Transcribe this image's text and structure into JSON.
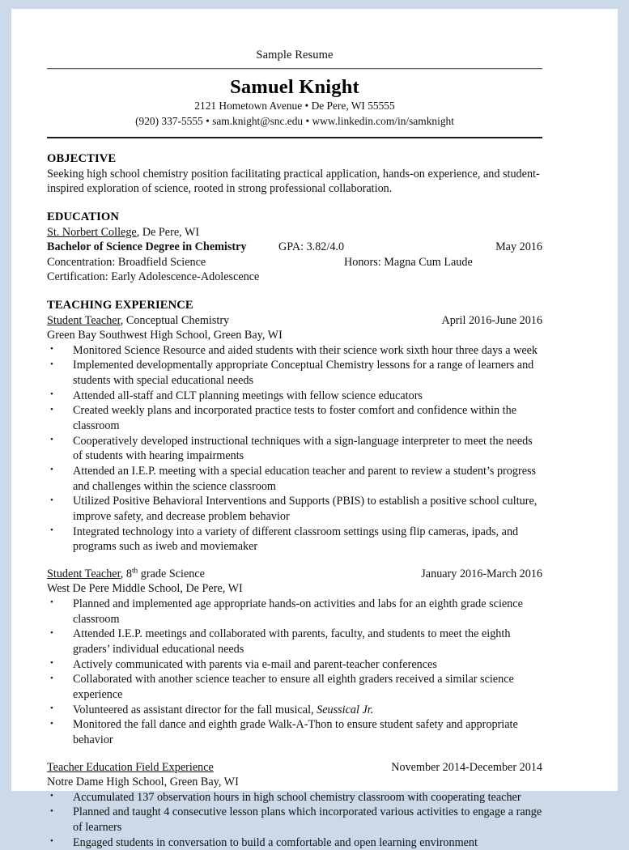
{
  "document": {
    "title": "Sample Resume"
  },
  "header": {
    "name": "Samuel Knight",
    "address_line": "2121 Hometown Avenue • De Pere, WI 55555",
    "contact_line": "(920) 337-5555 • sam.knight@snc.edu • www.linkedin.com/in/samknight"
  },
  "objective": {
    "heading": "OBJECTIVE",
    "text": "Seeking high school chemistry position facilitating practical application, hands-on experience, and student-inspired exploration of science, rooted in strong professional collaboration."
  },
  "education": {
    "heading": "EDUCATION",
    "school": "St. Norbert College",
    "school_location": ", De Pere, WI",
    "degree": "Bachelor of Science Degree in Chemistry",
    "gpa": "GPA: 3.82/4.0",
    "grad_date": "May 2016",
    "concentration": "Concentration: Broadfield Science",
    "honors": "Honors: Magna Cum Laude",
    "certification": "Certification: Early Adolescence-Adolescence"
  },
  "teaching_experience": {
    "heading": "TEACHING EXPERIENCE",
    "jobs": [
      {
        "title_underlined": "Student Teacher",
        "title_rest": ", Conceptual Chemistry",
        "dates": "April 2016-June 2016",
        "employer": "Green Bay Southwest High School, Green Bay, WI",
        "bullets": [
          "Monitored Science Resource and aided students with their science work sixth hour three days a week",
          "Implemented developmentally appropriate Conceptual Chemistry lessons for a range of learners and students with special educational needs",
          "Attended all-staff and CLT planning meetings with fellow science educators",
          "Created weekly plans and incorporated practice tests to foster comfort and confidence within the classroom",
          "Cooperatively developed instructional techniques with a sign-language interpreter to meet the needs of students with hearing impairments",
          "Attended an I.E.P. meeting with a special education teacher and parent to review a student’s progress and challenges within the science classroom",
          "Utilized Positive Behavioral Interventions and Supports (PBIS) to establish a positive school culture, improve safety, and decrease problem behavior",
          "Integrated technology into a variety of different classroom settings using flip cameras, ipads, and programs such as iweb and moviemaker"
        ]
      },
      {
        "title_underlined": "Student Teacher",
        "title_rest_pre": ", 8",
        "title_sup": "th",
        "title_rest_post": " grade Science",
        "dates": "January 2016-March 2016",
        "employer": "West De Pere Middle School, De Pere, WI",
        "bullets": [
          "Planned and implemented age appropriate hands-on activities and labs for an eighth grade science classroom",
          "Attended I.E.P. meetings and collaborated with parents, faculty, and students to meet the eighth graders’ individual educational needs",
          "Actively communicated with parents via e-mail and parent-teacher conferences",
          "Collaborated with another science teacher to ensure all eighth graders received a similar science experience"
        ],
        "bullet_musical_pre": "Volunteered as assistant director for the fall musical, ",
        "bullet_musical_italic": "Seussical Jr.",
        "bullet_last": "Monitored the fall dance and eighth grade Walk-A-Thon to ensure student safety and appropriate behavior"
      },
      {
        "title_underlined": "Teacher Education Field Experience",
        "dates": "November 2014-December 2014",
        "employer": "Notre Dame High School, Green Bay, WI",
        "bullets": [
          "Accumulated 137 observation hours in high school chemistry classroom with cooperating teacher",
          "Planned and taught 4 consecutive lesson plans which incorporated various activities to engage a range of learners",
          "Engaged students in conversation to build a comfortable and open learning environment"
        ]
      }
    ]
  },
  "colors": {
    "page_background": "#ccd9e8",
    "paper": "#ffffff",
    "text": "#111111",
    "rule_dark": "#1b1b1b",
    "rule_light": "#cfcfd1"
  }
}
